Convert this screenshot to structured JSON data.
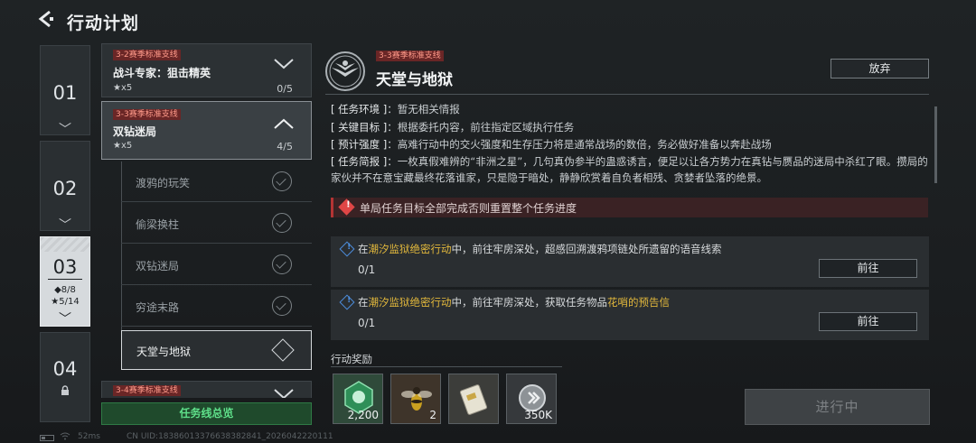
{
  "header": {
    "back_icon": "back-arrow-icon",
    "title": "行动计划"
  },
  "chapters": [
    {
      "num": "01"
    },
    {
      "num": "02"
    },
    {
      "num": "03",
      "diamonds": "◆8/8",
      "stars": "★5/14"
    },
    {
      "num": "04"
    }
  ],
  "mission_list": {
    "card1": {
      "tag": "3-2赛季标准支线",
      "name": "战斗专家：狙击精英",
      "stars": "★x5",
      "progress": "0/5"
    },
    "card2": {
      "tag": "3-3赛季标准支线",
      "name": "双钻迷局",
      "stars": "★x5",
      "progress": "4/5"
    },
    "subs": [
      {
        "label": "渡鸦的玩笑"
      },
      {
        "label": "偷梁换柱"
      },
      {
        "label": "双钻迷局"
      },
      {
        "label": "穷途末路"
      },
      {
        "label": "天堂与地狱"
      }
    ],
    "card3": {
      "tag": "3-4赛季标准支线"
    },
    "summary_label": "任务线总览"
  },
  "detail": {
    "tag": "3-3赛季标准支线",
    "title": "天堂与地狱",
    "abandon_label": "放弃",
    "env_key": "[ 任务环境 ]",
    "env_val": "：暂无相关情报",
    "target_key": "[ 关键目标 ]",
    "target_val": "：根据委托内容，前往指定区域执行任务",
    "intensity_key": "[ 预计强度 ]",
    "intensity_val": "：高难行动中的交火强度和生存压力将是通常战场的数倍，务必做好准备以奔赴战场",
    "brief_key": "[ 任务简报 ]",
    "brief_val": "：一枚真假难辨的“非洲之星”，几句真伪参半的蛊惑诱言，便足以让各方势力在真钻与赝品的迷局中杀红了眼。攒局的家伙并不在意宝藏最终花落谁家，只是隐于暗处，静静欣赏着自负者相残、贪婪者坠落的绝景。",
    "warning": "单局任务目标全部完成否则重置整个任务进度",
    "tasks": [
      {
        "pre": "在",
        "place": "潮汐监狱绝密行动",
        "mid": "中，前往牢房深处，超感回溯渡鸦项链处所遗留的语音线索",
        "item": "",
        "progress": "0/1",
        "go_label": "前往"
      },
      {
        "pre": "在",
        "place": "潮汐监狱绝密行动",
        "mid": "中，前往牢房深处，获取任务物品",
        "item": "花哨的预告信",
        "progress": "0/1",
        "go_label": "前往"
      }
    ],
    "reward_label": "行动奖励",
    "rewards": [
      {
        "icon": "green-token-icon",
        "qty": "2,200"
      },
      {
        "icon": "wasp-icon",
        "qty": "2"
      },
      {
        "icon": "letter-card-icon",
        "qty": ""
      },
      {
        "icon": "coin-icon",
        "qty": "350K"
      }
    ],
    "progress_button": "进行中"
  },
  "statusbar": {
    "ping": "52ms",
    "uid": "CN UID:18386013376638382841_2026042220111"
  }
}
